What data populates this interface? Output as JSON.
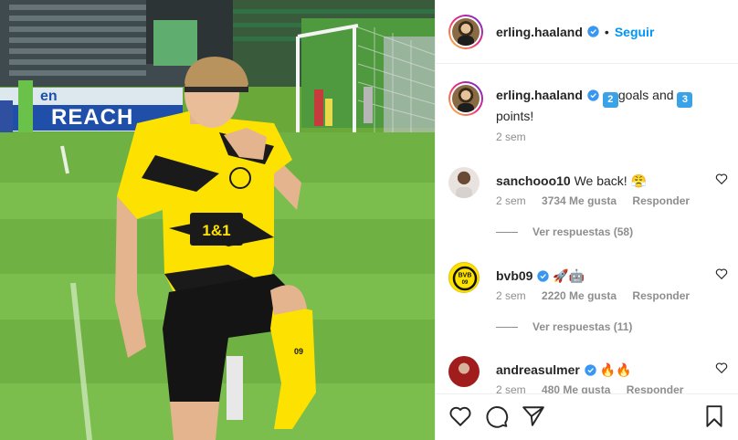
{
  "post": {
    "username": "erling.haaland",
    "follow_label": "Seguir",
    "separator": "•",
    "caption": {
      "username": "erling.haaland",
      "emoji_goals": "2",
      "text_1": "goals and",
      "emoji_points": "3",
      "text_2": "points!",
      "time": "2 sem"
    },
    "photo": {
      "banner_text": "REACH",
      "banner_prefix": "en",
      "shirt_sponsor": "1&1",
      "sock_number": "09"
    }
  },
  "comments": [
    {
      "username": "sanchooo10",
      "verified": false,
      "text": "We back! 😤",
      "time": "2 sem",
      "likes": "3734 Me gusta",
      "reply_label": "Responder",
      "view_replies": "Ver respuestas (58)"
    },
    {
      "username": "bvb09",
      "verified": true,
      "text": "🚀🤖",
      "time": "2 sem",
      "likes": "2220 Me gusta",
      "reply_label": "Responder",
      "view_replies": "Ver respuestas (11)"
    },
    {
      "username": "andreasulmer",
      "verified": true,
      "text": "🔥🔥",
      "time": "2 sem",
      "likes": "480 Me gusta",
      "reply_label": "Responder"
    }
  ],
  "icons": {
    "verified": "verified-badge-icon",
    "like": "heart-icon",
    "comment": "comment-bubble-icon",
    "share": "paper-plane-icon",
    "save": "bookmark-icon"
  },
  "colors": {
    "link_blue": "#0095f6",
    "verified_blue": "#3897f0",
    "bvb_yellow": "#fde100",
    "muted_text": "#8e8e8e"
  }
}
